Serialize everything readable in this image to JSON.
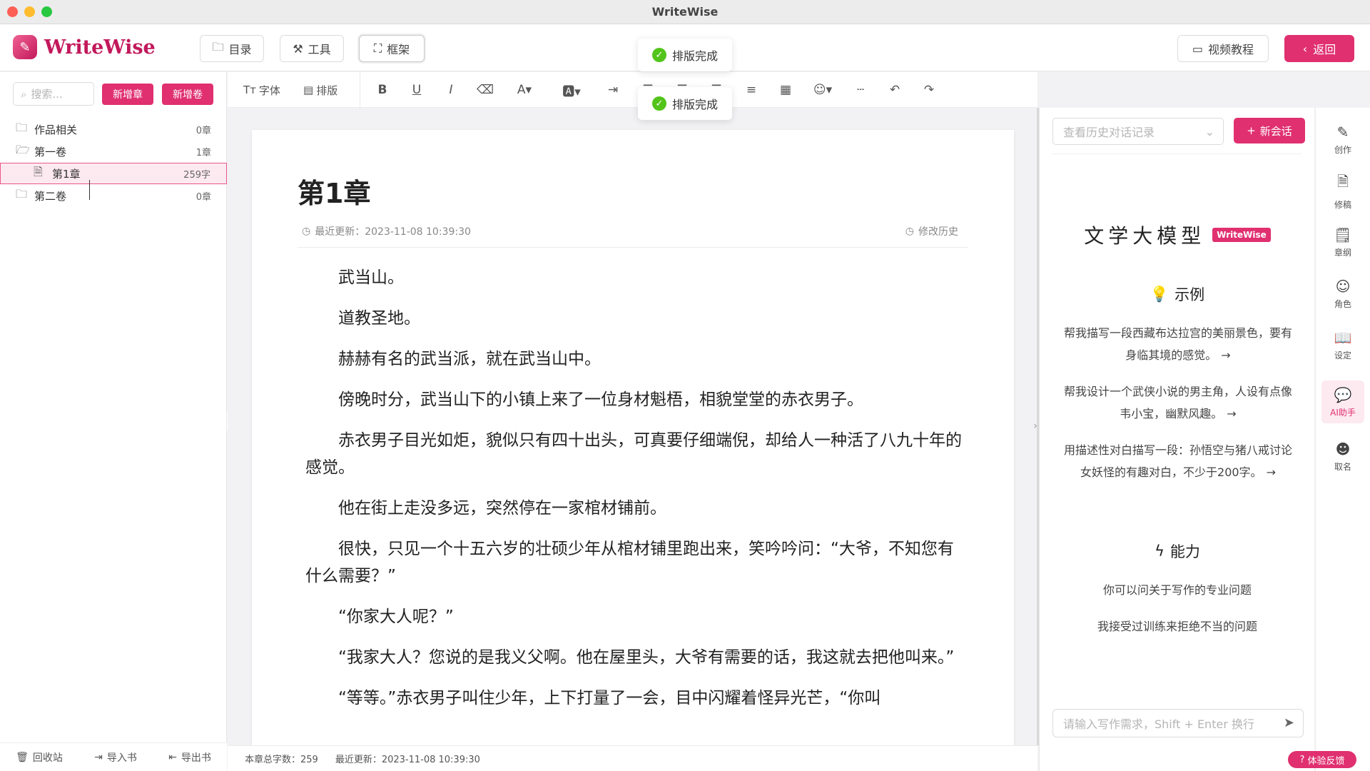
{
  "window": {
    "title": "WriteWise"
  },
  "header": {
    "brand": "WriteWise",
    "buttons": {
      "catalog": "目录",
      "tools": "工具",
      "framework": "框架",
      "video": "视频教程",
      "back": "返回"
    }
  },
  "toasts": [
    "排版完成",
    "排版完成"
  ],
  "sidebar": {
    "search_placeholder": "搜索...",
    "new_chapter": "新增章",
    "new_volume": "新增卷",
    "tree": [
      {
        "label": "作品相关",
        "count": "0章"
      },
      {
        "label": "第一卷",
        "count": "1章"
      },
      {
        "label": "第1章",
        "count": "259字"
      },
      {
        "label": "第二卷",
        "count": "0章"
      }
    ],
    "footer": {
      "recycle": "回收站",
      "import": "导入书",
      "export": "导出书"
    }
  },
  "toolbar": {
    "font": "字体",
    "layout": "排版"
  },
  "editor": {
    "chapter_title": "第1章",
    "updated": "最近更新：2023-11-08 10:39:30",
    "history": "修改历史",
    "paragraphs": [
      "武当山。",
      "道教圣地。",
      "赫赫有名的武当派，就在武当山中。",
      "傍晚时分，武当山下的小镇上来了一位身材魁梧，相貌堂堂的赤衣男子。",
      "赤衣男子目光如炬，貌似只有四十出头，可真要仔细端倪，却给人一种活了八九十年的感觉。",
      "他在街上走没多远，突然停在一家棺材铺前。",
      "很快，只见一个十五六岁的壮硕少年从棺材铺里跑出来，笑吟吟问：“大爷，不知您有什么需要？”",
      "“你家大人呢？”",
      "“我家大人？您说的是我义父啊。他在屋里头，大爷有需要的话，我这就去把他叫来。”",
      "“等等。”赤衣男子叫住少年，上下打量了一会，目中闪耀着怪异光芒，“你叫"
    ]
  },
  "status": {
    "word_count": "本章总字数：259",
    "updated": "最近更新：2023-11-08 10:39:30"
  },
  "ai": {
    "history_placeholder": "查看历史对话记录",
    "new_chat": "新会话",
    "title": "文学大模型",
    "badge": "WriteWise",
    "examples_title": "示例",
    "examples": [
      "帮我描写一段西藏布达拉宫的美丽景色，要有身临其境的感觉。",
      "帮我设计一个武侠小说的男主角，人设有点像韦小宝，幽默风趣。",
      "用描述性对白描写一段：孙悟空与猪八戒讨论女妖怪的有趣对白，不少于200字。"
    ],
    "abilities_title": "能力",
    "abilities": [
      "你可以问关于写作的专业问题",
      "我接受过训练来拒绝不当的问题"
    ],
    "input_placeholder": "请输入写作需求，Shift + Enter 换行"
  },
  "rail": [
    "创作",
    "修稿",
    "章纲",
    "角色",
    "设定",
    "AI助手",
    "取名"
  ],
  "feedback": "体验反馈",
  "colors": {
    "accent": "#e0306f",
    "success": "#52c41a"
  }
}
